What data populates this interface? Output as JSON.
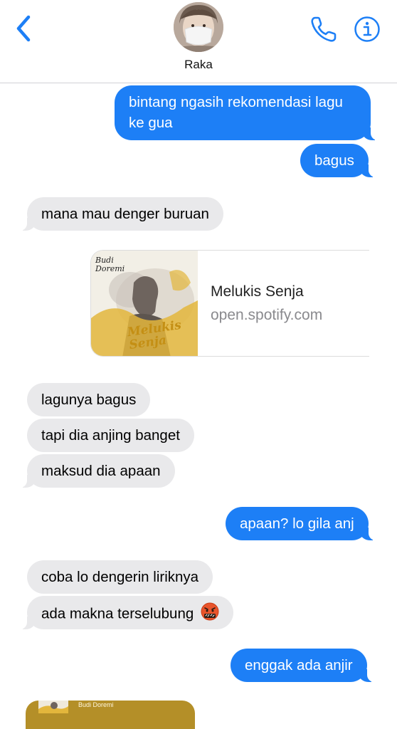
{
  "header": {
    "contact_name": "Raka"
  },
  "messages": [
    {
      "direction": "out",
      "text": "bintang ngasih rekomendasi lagu ke gua"
    },
    {
      "direction": "out",
      "text": "bagus"
    },
    {
      "direction": "in",
      "text": "mana mau denger buruan"
    },
    {
      "direction": "in",
      "type": "link",
      "title": "Melukis Senja",
      "domain": "open.spotify.com",
      "thumb_artist": "Budi Doremi",
      "thumb_title": "Melukis Senja"
    },
    {
      "direction": "in",
      "text": "lagunya bagus"
    },
    {
      "direction": "in",
      "text": "tapi dia anjing banget"
    },
    {
      "direction": "in",
      "text": "maksud dia apaan"
    },
    {
      "direction": "out",
      "text": "apaan? lo gila anj"
    },
    {
      "direction": "in",
      "text": "coba lo dengerin liriknya"
    },
    {
      "direction": "in",
      "text": "ada makna terselubung",
      "emoji": "face-with-symbols-on-mouth-icon"
    },
    {
      "direction": "out",
      "text": "enggak ada anjir"
    },
    {
      "direction": "in",
      "type": "media",
      "label": "Budi Doremi"
    }
  ],
  "colors": {
    "outgoing_bubble": "#1d7ff6",
    "incoming_bubble": "#e9e9eb",
    "accent": "#1d7ff6"
  },
  "icons": {
    "back": "chevron-left-icon",
    "call": "phone-icon",
    "info": "info-icon"
  }
}
